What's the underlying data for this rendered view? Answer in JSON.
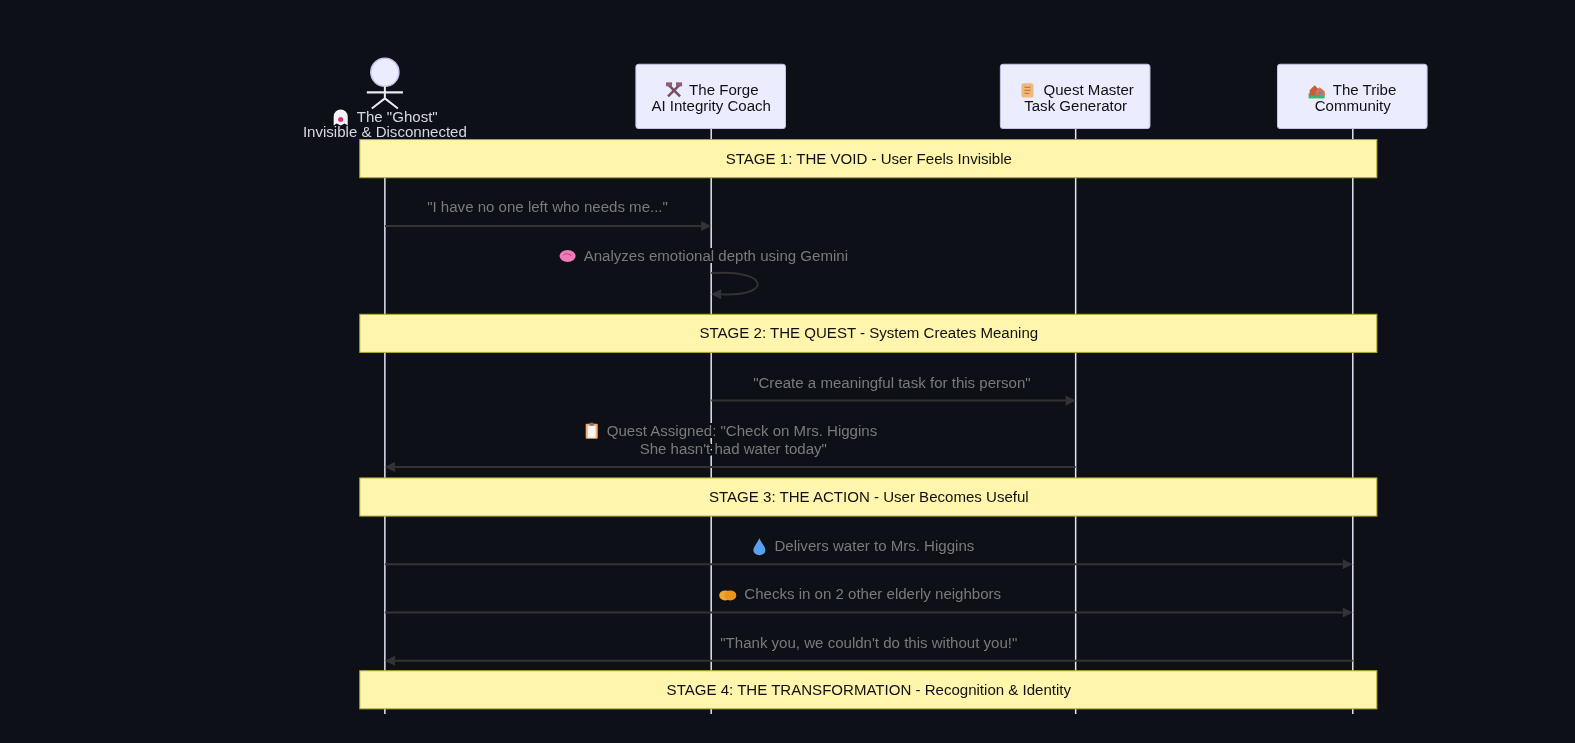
{
  "participants": [
    {
      "kind": "actor",
      "lines": [
        "The \"Ghost\"",
        "Invisible & Disconnected"
      ]
    },
    {
      "kind": "box",
      "lines": [
        "The Forge",
        "AI Integrity Coach"
      ]
    },
    {
      "kind": "box",
      "lines": [
        "Quest Master",
        "Task Generator"
      ]
    },
    {
      "kind": "box",
      "lines": [
        "The Tribe",
        "Community"
      ]
    }
  ],
  "sequence": [
    {
      "kind": "note",
      "lines": [
        "STAGE 1: THE VOID - User Feels Invisible"
      ]
    },
    {
      "kind": "message",
      "lines": [
        "\"I have no one left who needs me...\""
      ]
    },
    {
      "kind": "self",
      "lines": [
        "Analyzes emotional depth using Gemini"
      ]
    },
    {
      "kind": "note",
      "lines": [
        "STAGE 2: THE QUEST - System Creates Meaning"
      ]
    },
    {
      "kind": "message",
      "lines": [
        "\"Create a meaningful task for this person\""
      ]
    },
    {
      "kind": "message",
      "lines": [
        "Quest Assigned: \"Check on Mrs. Higgins",
        "She hasn't had water today\""
      ]
    },
    {
      "kind": "note",
      "lines": [
        "STAGE 3: THE ACTION - User Becomes Useful"
      ]
    },
    {
      "kind": "message",
      "lines": [
        "Delivers water to Mrs. Higgins"
      ]
    },
    {
      "kind": "message",
      "lines": [
        "Checks in on 2 other elderly neighbors"
      ]
    },
    {
      "kind": "message",
      "lines": [
        "\"Thank you, we couldn't do this without you!\""
      ]
    },
    {
      "kind": "note",
      "lines": [
        "STAGE 4: THE TRANSFORMATION - Recognition & Identity"
      ]
    }
  ]
}
